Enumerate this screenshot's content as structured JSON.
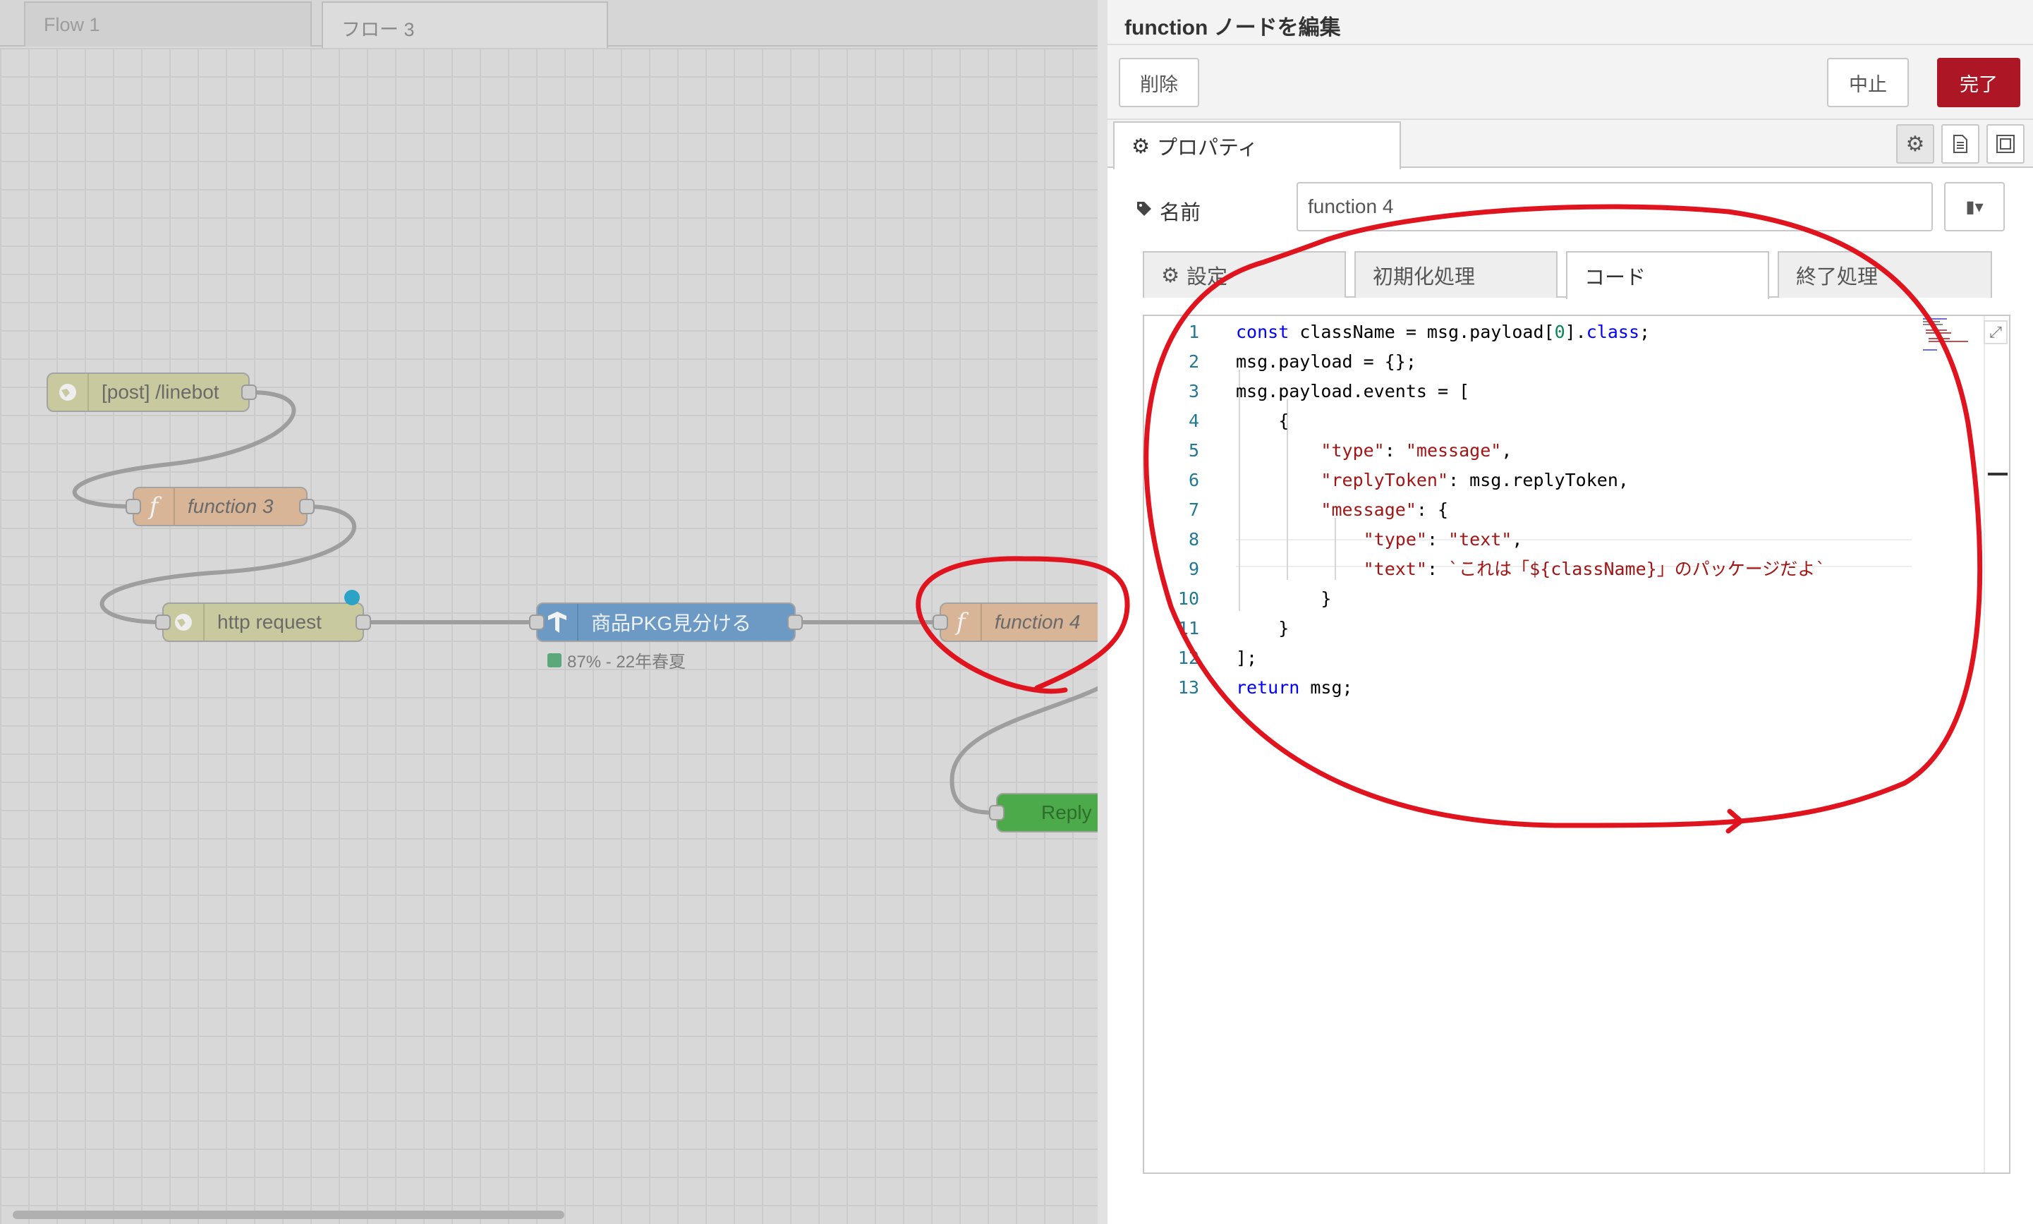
{
  "workspace": {
    "tabs": [
      {
        "label": "Flow 1"
      },
      {
        "label": "フロー 3"
      }
    ],
    "nodes": {
      "linebot": {
        "label": "[post] /linebot",
        "icon": "globe-icon"
      },
      "function3": {
        "label": "function 3",
        "icon": "function-icon"
      },
      "http_request": {
        "label": "http request",
        "icon": "globe-icon"
      },
      "pkg": {
        "label": "商品PKG見分ける",
        "icon": "tensorflow-icon",
        "status": "87% - 22年春夏"
      },
      "function4": {
        "label": "function 4",
        "icon": "function-icon"
      },
      "reply": {
        "label": "Reply"
      }
    },
    "colors": {
      "function_node": "#d7b596",
      "http_node": "#c9c99f",
      "tf_node": "#6c9ac4",
      "reply_node": "#4daa4a"
    }
  },
  "editor": {
    "title": "function ノードを編集",
    "buttons": {
      "delete": "削除",
      "cancel": "中止",
      "done": "完了"
    },
    "colors": {
      "done_button": "#ad1625"
    },
    "properties_tab": "プロパティ",
    "name_label": "名前",
    "name_value": "function 4",
    "code_tabs": {
      "settings": "設定",
      "init": "初期化処理",
      "code": "コード",
      "close": "終了処理"
    },
    "code_lines": [
      {
        "n": "1",
        "html": "<span class=\"kw\">const</span> className = msg.payload[<span class=\"num\">0</span>].<span class=\"kw\">class</span>;"
      },
      {
        "n": "2",
        "html": "msg.payload = {};"
      },
      {
        "n": "3",
        "html": "msg.payload.events = ["
      },
      {
        "n": "4",
        "html": "    {"
      },
      {
        "n": "5",
        "html": "        <span class=\"str\">\"type\"</span>: <span class=\"str\">\"message\"</span>,"
      },
      {
        "n": "6",
        "html": "        <span class=\"str\">\"replyToken\"</span>: msg.replyToken,"
      },
      {
        "n": "7",
        "html": "        <span class=\"str\">\"message\"</span>: {"
      },
      {
        "n": "8",
        "html": "            <span class=\"str\">\"type\"</span>: <span class=\"str\">\"text\"</span>,"
      },
      {
        "n": "9",
        "html": "            <span class=\"str\">\"text\"</span>: <span class=\"str\">`これは「${className}」のパッケージだよ`</span>"
      },
      {
        "n": "10",
        "html": "        }"
      },
      {
        "n": "11",
        "html": "    }"
      },
      {
        "n": "12",
        "html": "];"
      },
      {
        "n": "13",
        "html": "<span class=\"kw\">return</span> msg;"
      }
    ],
    "annotation_color": "#e0141e"
  }
}
